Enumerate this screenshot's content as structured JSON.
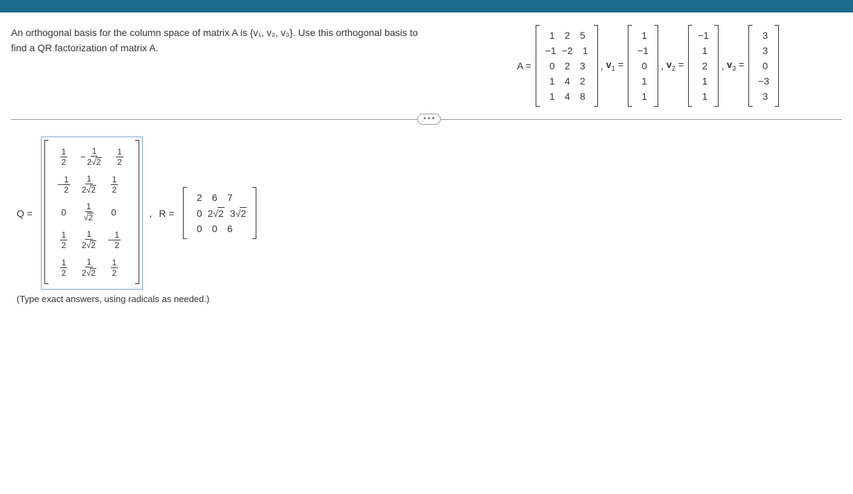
{
  "problem": {
    "line1_a": "An orthogonal basis for the column space of matrix A is ",
    "basis": "{v₁, v₂, v₃}",
    "line1_b": ". Use this orthogonal basis to",
    "line2": "find a QR factorization of matrix A."
  },
  "labels": {
    "A": "A =",
    "v1": "v₁ =",
    "v2": "v₂ =",
    "v3": "v₃ =",
    "Q": "Q =",
    "R": "R ="
  },
  "A": [
    [
      "1",
      "2",
      "5"
    ],
    [
      "−1",
      "−2",
      "1"
    ],
    [
      "0",
      "2",
      "3"
    ],
    [
      "1",
      "4",
      "2"
    ],
    [
      "1",
      "4",
      "8"
    ]
  ],
  "v1": [
    "1",
    "−1",
    "0",
    "1",
    "1"
  ],
  "v2": [
    "−1",
    "1",
    "2",
    "1",
    "1"
  ],
  "v3": [
    "3",
    "3",
    "0",
    "−3",
    "3"
  ],
  "Q": [
    [
      {
        "t": "frac",
        "n": "1",
        "d": "2",
        "neg": false
      },
      {
        "t": "frac",
        "n": "1",
        "d": "2√2",
        "neg": true
      },
      {
        "t": "frac",
        "n": "1",
        "d": "2",
        "neg": false
      }
    ],
    [
      {
        "t": "frac",
        "n": "1",
        "d": "2",
        "neg": true
      },
      {
        "t": "frac",
        "n": "1",
        "d": "2√2",
        "neg": false
      },
      {
        "t": "frac",
        "n": "1",
        "d": "2",
        "neg": false
      }
    ],
    [
      {
        "t": "plain",
        "v": "0"
      },
      {
        "t": "frac",
        "n": "1",
        "d": "√2",
        "neg": false
      },
      {
        "t": "plain",
        "v": "0"
      }
    ],
    [
      {
        "t": "frac",
        "n": "1",
        "d": "2",
        "neg": false
      },
      {
        "t": "frac",
        "n": "1",
        "d": "2√2",
        "neg": false
      },
      {
        "t": "frac",
        "n": "1",
        "d": "2",
        "neg": true
      }
    ],
    [
      {
        "t": "frac",
        "n": "1",
        "d": "2",
        "neg": false
      },
      {
        "t": "frac",
        "n": "1",
        "d": "2√2",
        "neg": false
      },
      {
        "t": "frac",
        "n": "1",
        "d": "2",
        "neg": false
      }
    ]
  ],
  "R": [
    [
      "2",
      "6",
      "7"
    ],
    [
      "0",
      "2√2",
      "3√2"
    ],
    [
      "0",
      "0",
      "6"
    ]
  ],
  "hint": "(Type exact answers, using radicals as needed.)",
  "dots": "• • •"
}
